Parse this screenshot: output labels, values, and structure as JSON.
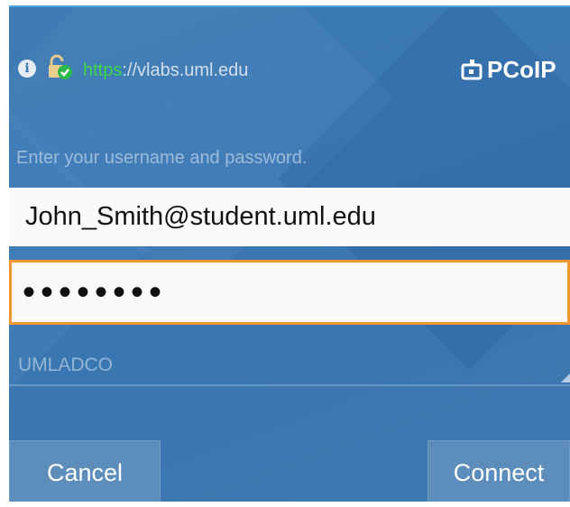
{
  "urlbar": {
    "scheme": "https",
    "rest": "://vlabs.uml.edu",
    "info_icon": "info-icon",
    "lock_icon": "lock-check-icon"
  },
  "brand": {
    "name": "PCoIP",
    "icon": "pcoip-logo-icon"
  },
  "login": {
    "prompt": "Enter your username and password.",
    "username_value": "John_Smith@student.uml.edu",
    "password_value": "••••••••",
    "domain_value": "UMLADCO"
  },
  "buttons": {
    "cancel_label": "Cancel",
    "connect_label": "Connect"
  },
  "colors": {
    "background": "#3b79b5",
    "focus_border": "#f3962f",
    "scheme_green": "#3dd64b"
  }
}
